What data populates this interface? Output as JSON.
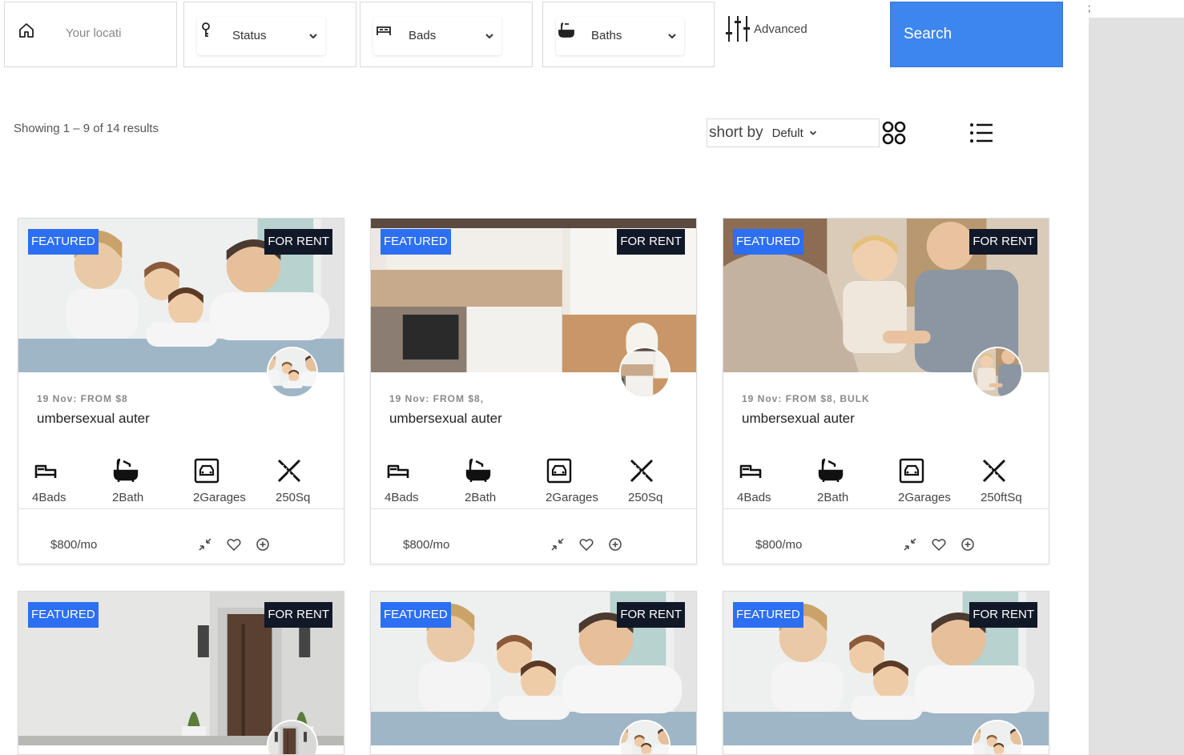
{
  "filters": {
    "location_placeholder": "Your location",
    "status_label": "Status",
    "beds_label": "Bads",
    "baths_label": "Baths",
    "advanced_label": "Advanced",
    "search_label": "Search"
  },
  "toolbar": {
    "results_text": "Showing 1 – 9 of 14 results",
    "sort_label": "short by",
    "sort_value": "Defult"
  },
  "gutter_text": ";",
  "cards": [
    {
      "featured": "FEATURED",
      "status": "FOR RENT",
      "meta": "19 Nov: FROM $8",
      "title": "umbersexual auter",
      "beds": "4Bads",
      "baths": "2Bath",
      "garages": "2Garages",
      "area": "250Sq",
      "price": "$800/mo",
      "photo": "family"
    },
    {
      "featured": "FEATURED",
      "status": "FOR RENT",
      "meta": "19 Nov: FROM $8,",
      "title": "umbersexual auter",
      "beds": "4Bads",
      "baths": "2Bath",
      "garages": "2Garages",
      "area": "250Sq",
      "price": "$800/mo",
      "photo": "kitchen"
    },
    {
      "featured": "FEATURED",
      "status": "FOR RENT",
      "meta": "19 Nov: FROM $8, BULK",
      "title": "umbersexual auter",
      "beds": "4Bads",
      "baths": "2Bath",
      "garages": "2Garages",
      "area": "250ftSq",
      "price": "$800/mo",
      "photo": "handshake"
    },
    {
      "featured": "FEATURED",
      "status": "FOR RENT",
      "photo": "door"
    },
    {
      "featured": "FEATURED",
      "status": "FOR RENT",
      "photo": "family"
    },
    {
      "featured": "FEATURED",
      "status": "FOR RENT",
      "photo": "family"
    }
  ],
  "colors": {
    "accent": "#3d86f0",
    "featured_badge": "#2c6ff2",
    "rent_badge": "#111827"
  }
}
